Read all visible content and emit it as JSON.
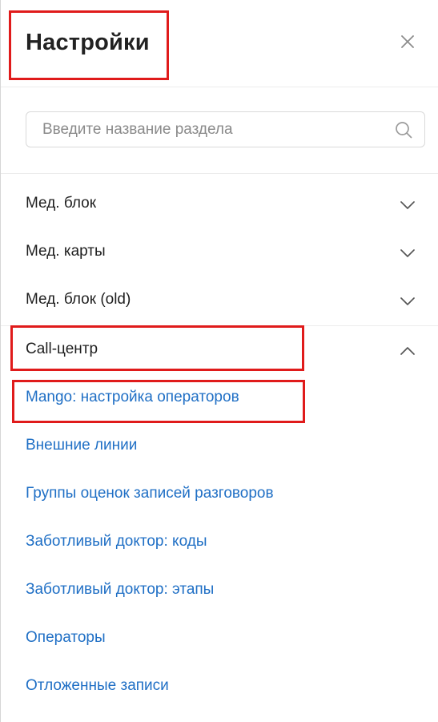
{
  "header": {
    "title": "Настройки"
  },
  "search": {
    "placeholder": "Введите название раздела",
    "value": ""
  },
  "sections": [
    {
      "label": "Мед. блок",
      "expanded": false
    },
    {
      "label": "Мед. карты",
      "expanded": false
    },
    {
      "label": "Мед. блок (old)",
      "expanded": false
    },
    {
      "label": "Call-центр",
      "expanded": true,
      "items": [
        "Mango: настройка операторов",
        "Внешние линии",
        "Группы оценок записей разговоров",
        "Заботливый доктор: коды",
        "Заботливый доктор: этапы",
        "Операторы",
        "Отложенные записи"
      ]
    }
  ],
  "colors": {
    "link": "#1f6fc5",
    "highlight": "#e01b1b",
    "text": "#1f1f1f",
    "divider": "#ececec"
  },
  "icons": {
    "close": "close-icon",
    "search": "search-icon",
    "collapsed": "chevron-down-icon",
    "expanded": "chevron-up-icon"
  }
}
